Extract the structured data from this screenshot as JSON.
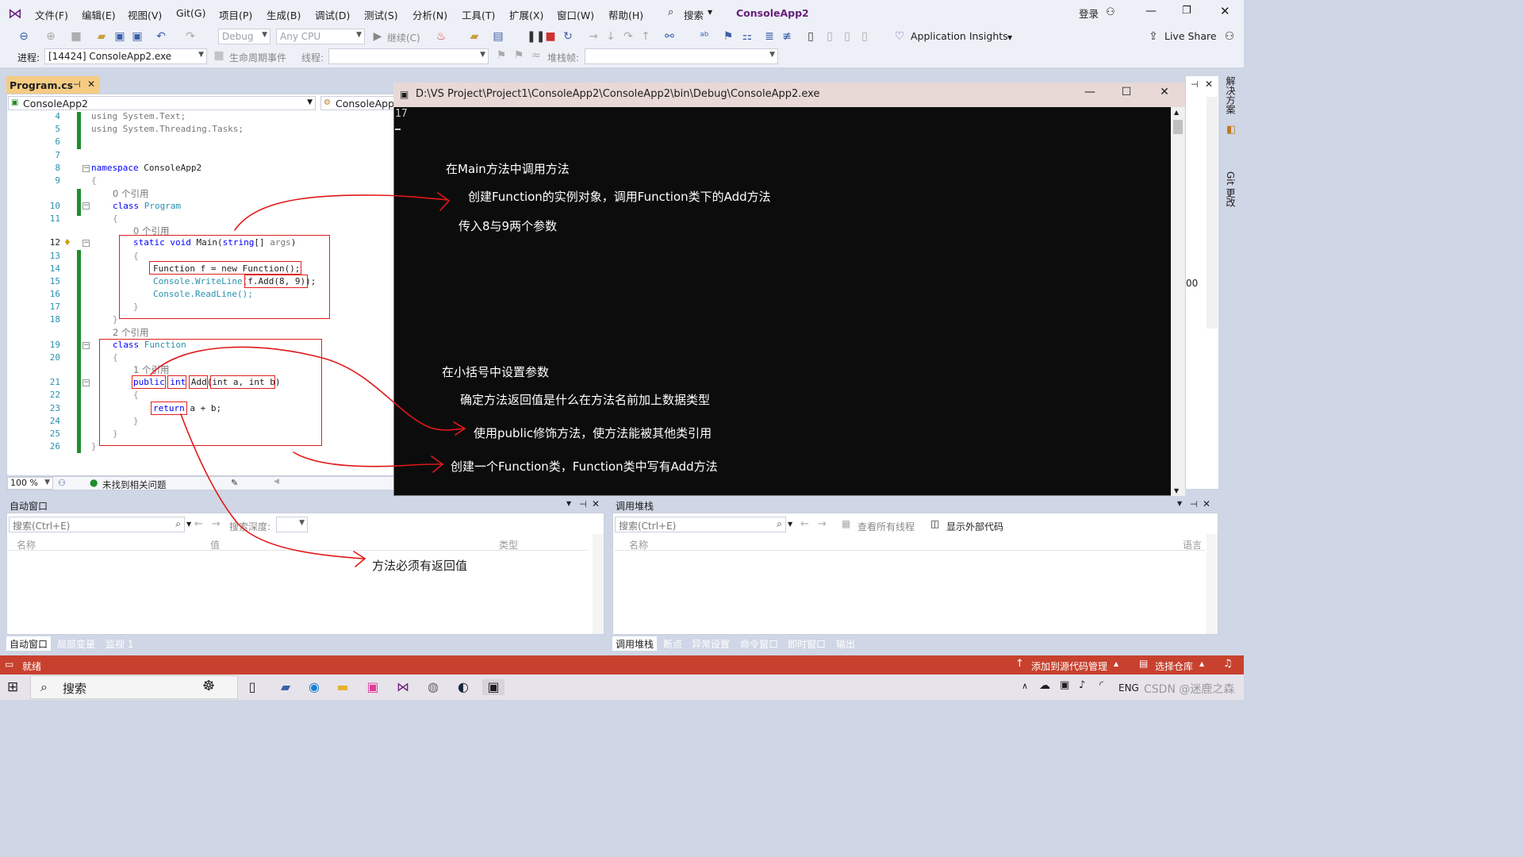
{
  "menu": {
    "items": [
      "文件(F)",
      "编辑(E)",
      "视图(V)",
      "Git(G)",
      "项目(P)",
      "生成(B)",
      "调试(D)",
      "测试(S)",
      "分析(N)",
      "工具(T)",
      "扩展(X)",
      "窗口(W)",
      "帮助(H)"
    ],
    "search_label": "搜索",
    "app_title": "ConsoleApp2",
    "login": "登录"
  },
  "toolbar": {
    "config": "Debug",
    "platform": "Any CPU",
    "continue": "继续(C)",
    "app_insights": "Application Insights",
    "live_share": "Live Share"
  },
  "debugbar": {
    "process_label": "进程:",
    "process_value": "[14424] ConsoleApp2.exe",
    "lifecycle": "生命周期事件",
    "thread_label": "线程:",
    "stack_label": "堆栈帧:"
  },
  "editor": {
    "file_tab": "Program.cs",
    "nav_project": "ConsoleApp2",
    "nav_class": "ConsoleApp2",
    "zoom": "100 %",
    "issues": "未找到相关问题",
    "refs": {
      "zero": "0 个引用",
      "two": "2 个引用",
      "one": "1 个引用"
    },
    "lines": {
      "l4": "using System.Text;",
      "l5": "using System.Threading.Tasks;",
      "ns_kw": "namespace",
      "ns_name": " ConsoleApp2",
      "class_kw": "class",
      "program": " Program",
      "main_sig": "static void Main(string[] args)",
      "l14": "Function f = new Function();",
      "l15a": "Console.WriteLine(",
      "l15b": "f.Add(8, 9)",
      "l15c": ");",
      "l16": "Console.ReadLine();",
      "function": " Function",
      "public": "public",
      "int": "int",
      "add": "Add",
      "params": "int a, int b",
      "close_paren": ")",
      "return": "return",
      "ret_expr": " a + b;"
    },
    "line_numbers": [
      "4",
      "5",
      "6",
      "7",
      "8",
      "9",
      "10",
      "11",
      "12",
      "13",
      "14",
      "15",
      "16",
      "17",
      "18",
      "19",
      "20",
      "21",
      "22",
      "23",
      "24",
      "25",
      "26"
    ]
  },
  "console": {
    "title": "D:\\VS Project\\Project1\\ConsoleApp2\\ConsoleApp2\\bin\\Debug\\ConsoleApp2.exe",
    "output": "17",
    "notes": {
      "n1": "在Main方法中调用方法",
      "n2": "创建Function的实例对象，调用Function类下的Add方法",
      "n3": "传入8与9两个参数",
      "n4": "在小括号中设置参数",
      "n5": "确定方法返回值是什么在方法名前加上数据类型",
      "n6": "使用public修饰方法，使方法能被其他类引用",
      "n7": "创建一个Function类，Function类中写有Add方法",
      "n8": "方法必须有返回值"
    }
  },
  "right_panel": {
    "vtab1": "解决方案",
    "vtab2": "Git 更改",
    "partial_value": "00"
  },
  "autos": {
    "title": "自动窗口",
    "search": "搜索(Ctrl+E)",
    "search_depth": "搜索深度:",
    "col_name": "名称",
    "col_value": "值",
    "col_type": "类型",
    "tabs": [
      "自动窗口",
      "局部变量",
      "监视 1"
    ]
  },
  "callstack": {
    "title": "调用堆栈",
    "search": "搜索(Ctrl+E)",
    "view_threads": "查看所有线程",
    "show_external": "显示外部代码",
    "col_name": "名称",
    "col_lang": "语言",
    "tabs": [
      "调用堆栈",
      "断点",
      "异常设置",
      "命令窗口",
      "即时窗口",
      "输出"
    ]
  },
  "statusbar": {
    "ready": "就绪",
    "source_control": "添加到源代码管理",
    "select_repo": "选择仓库"
  },
  "taskbar": {
    "search": "搜索",
    "lang": "ENG",
    "watermark": "CSDN @迷鹿之森"
  }
}
